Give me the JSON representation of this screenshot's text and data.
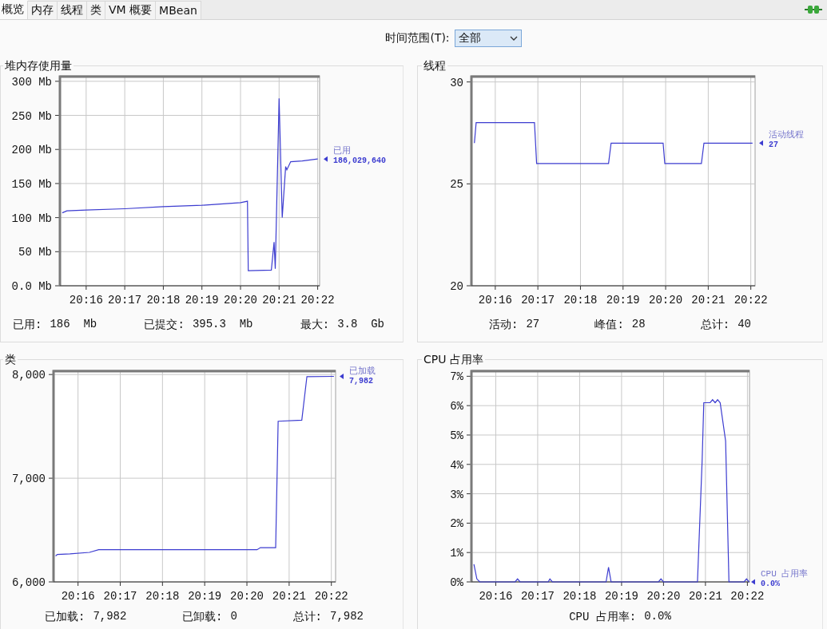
{
  "tabs": [
    {
      "label": "概览",
      "selected": true
    },
    {
      "label": "内存",
      "selected": false
    },
    {
      "label": "线程",
      "selected": false
    },
    {
      "label": "类",
      "selected": false
    },
    {
      "label": "VM 概要",
      "selected": false
    },
    {
      "label": "MBean",
      "selected": false
    }
  ],
  "time_range": {
    "label": "时间范围(T):",
    "value": "全部"
  },
  "panels": [
    {
      "title": "堆内存使用量",
      "legend_value": "186,029,640",
      "chart_data": {
        "type": "line",
        "x": [
          1215.38,
          1215.5,
          1216,
          1217,
          1218,
          1219,
          1220,
          1220.18,
          1220.2,
          1220.8,
          1220.87,
          1220.9,
          1221.0,
          1221.08,
          1221.17,
          1221.2,
          1221.3,
          1221.6,
          1222.0
        ],
        "series": [
          {
            "name": "已用",
            "color": "#3c3cd0",
            "values": [
              107,
              110,
              111,
              113,
              116,
              118,
              122,
              124,
              22,
              23,
              64,
              25,
              275,
              100,
              175,
              170,
              182,
              183,
              186
            ]
          }
        ],
        "grid": true,
        "xlim": [
          1215.32,
          1222.05
        ],
        "ylim": [
          0,
          308
        ],
        "xticks": [
          {
            "value": 1216,
            "label": "20:16"
          },
          {
            "value": 1217,
            "label": "20:17"
          },
          {
            "value": 1218,
            "label": "20:18"
          },
          {
            "value": 1219,
            "label": "20:19"
          },
          {
            "value": 1220,
            "label": "20:20"
          },
          {
            "value": 1221,
            "label": "20:21"
          },
          {
            "value": 1222,
            "label": "20:22"
          }
        ],
        "yticks": [
          {
            "value": 0,
            "label": "0.0 Mb"
          },
          {
            "value": 50,
            "label": "50 Mb"
          },
          {
            "value": 100,
            "label": "100 Mb"
          },
          {
            "value": 150,
            "label": "150 Mb"
          },
          {
            "value": 200,
            "label": "200 Mb"
          },
          {
            "value": 250,
            "label": "250 Mb"
          },
          {
            "value": 300,
            "label": "300 Mb"
          }
        ]
      },
      "stats": [
        {
          "label": "已用:",
          "value": "186  Mb"
        },
        {
          "label": "已提交:",
          "value": "395.3  Mb"
        },
        {
          "label": "最大:",
          "value": "3.8  Gb"
        }
      ]
    },
    {
      "title": "线程",
      "legend_value": "27",
      "chart_data": {
        "type": "line",
        "x": [
          1215.51,
          1215.55,
          1216.92,
          1216.97,
          1218.66,
          1218.72,
          1219.94,
          1219.98,
          1220.84,
          1220.9,
          1222.04
        ],
        "series": [
          {
            "name": "活动线程",
            "color": "#3c3cd0",
            "values": [
              27,
              28,
              28,
              26,
              26,
              27,
              27,
              26,
              26,
              27,
              27
            ]
          }
        ],
        "grid": true,
        "xlim": [
          1215.44,
          1222.1
        ],
        "ylim": [
          20,
          30.3
        ],
        "xticks": [
          {
            "value": 1216,
            "label": "20:16"
          },
          {
            "value": 1217,
            "label": "20:17"
          },
          {
            "value": 1218,
            "label": "20:18"
          },
          {
            "value": 1219,
            "label": "20:19"
          },
          {
            "value": 1220,
            "label": "20:20"
          },
          {
            "value": 1221,
            "label": "20:21"
          },
          {
            "value": 1222,
            "label": "20:22"
          }
        ],
        "yticks": [
          {
            "value": 20,
            "label": "20"
          },
          {
            "value": 25,
            "label": "25"
          },
          {
            "value": 30,
            "label": "30"
          }
        ]
      },
      "stats": [
        {
          "label": "活动:",
          "value": "27"
        },
        {
          "label": "峰值:",
          "value": "28"
        },
        {
          "label": "总计:",
          "value": "40"
        }
      ]
    },
    {
      "title": "类",
      "legend_value": "7,982",
      "chart_data": {
        "type": "line",
        "x": [
          1215.47,
          1215.51,
          1215.81,
          1216.27,
          1216.49,
          1220.24,
          1220.32,
          1220.68,
          1220.74,
          1221.3,
          1221.42,
          1222.06
        ],
        "series": [
          {
            "name": "已加载",
            "color": "#3c3cd0",
            "values": [
              6250,
              6265,
              6270,
              6285,
              6310,
              6310,
              6330,
              6330,
              7550,
              7560,
              7980,
              7982
            ]
          }
        ],
        "grid": true,
        "xlim": [
          1215.42,
          1222.1
        ],
        "ylim": [
          6000,
          8040
        ],
        "xticks": [
          {
            "value": 1216,
            "label": "20:16"
          },
          {
            "value": 1217,
            "label": "20:17"
          },
          {
            "value": 1218,
            "label": "20:18"
          },
          {
            "value": 1219,
            "label": "20:19"
          },
          {
            "value": 1220,
            "label": "20:20"
          },
          {
            "value": 1221,
            "label": "20:21"
          },
          {
            "value": 1222,
            "label": "20:22"
          }
        ],
        "yticks": [
          {
            "value": 6000,
            "label": "6,000"
          },
          {
            "value": 7000,
            "label": "7,000"
          },
          {
            "value": 8000,
            "label": "8,000"
          }
        ]
      },
      "stats": [
        {
          "label": "已加载:",
          "value": "7,982"
        },
        {
          "label": "已卸载:",
          "value": "0"
        },
        {
          "label": "总计:",
          "value": "7,982"
        }
      ]
    },
    {
      "title": "CPU 占用率",
      "legend_value": "0.0%",
      "chart_data": {
        "type": "line",
        "x": [
          1215.48,
          1215.55,
          1215.62,
          1216.46,
          1216.52,
          1216.58,
          1217.25,
          1217.29,
          1217.35,
          1218.63,
          1218.69,
          1218.75,
          1219.88,
          1219.94,
          1220.0,
          1220.81,
          1220.92,
          1220.96,
          1221.11,
          1221.17,
          1221.23,
          1221.29,
          1221.35,
          1221.48,
          1221.56,
          1221.92,
          1221.98,
          1222.04
        ],
        "series": [
          {
            "name": "CPU 占用率",
            "color": "#3c3cd0",
            "values": [
              0.6,
              0.1,
              0,
              0,
              0.1,
              0,
              0,
              0.1,
              0,
              0,
              0.5,
              0,
              0,
              0.1,
              0,
              0,
              4.1,
              6.1,
              6.1,
              6.2,
              6.1,
              6.2,
              6.1,
              4.8,
              0,
              0,
              0.1,
              0
            ]
          }
        ],
        "grid": true,
        "xlim": [
          1215.42,
          1222.05
        ],
        "ylim": [
          0,
          7.2
        ],
        "xticks": [
          {
            "value": 1216,
            "label": "20:16"
          },
          {
            "value": 1217,
            "label": "20:17"
          },
          {
            "value": 1218,
            "label": "20:18"
          },
          {
            "value": 1219,
            "label": "20:19"
          },
          {
            "value": 1220,
            "label": "20:20"
          },
          {
            "value": 1221,
            "label": "20:21"
          },
          {
            "value": 1222,
            "label": "20:22"
          }
        ],
        "yticks": [
          {
            "value": 0,
            "label": "0%"
          },
          {
            "value": 1,
            "label": "1%"
          },
          {
            "value": 2,
            "label": "2%"
          },
          {
            "value": 3,
            "label": "3%"
          },
          {
            "value": 4,
            "label": "4%"
          },
          {
            "value": 5,
            "label": "5%"
          },
          {
            "value": 6,
            "label": "6%"
          },
          {
            "value": 7,
            "label": "7%"
          }
        ]
      },
      "stats": [
        {
          "label": "CPU 占用率:",
          "value": "0.0%"
        }
      ]
    }
  ]
}
